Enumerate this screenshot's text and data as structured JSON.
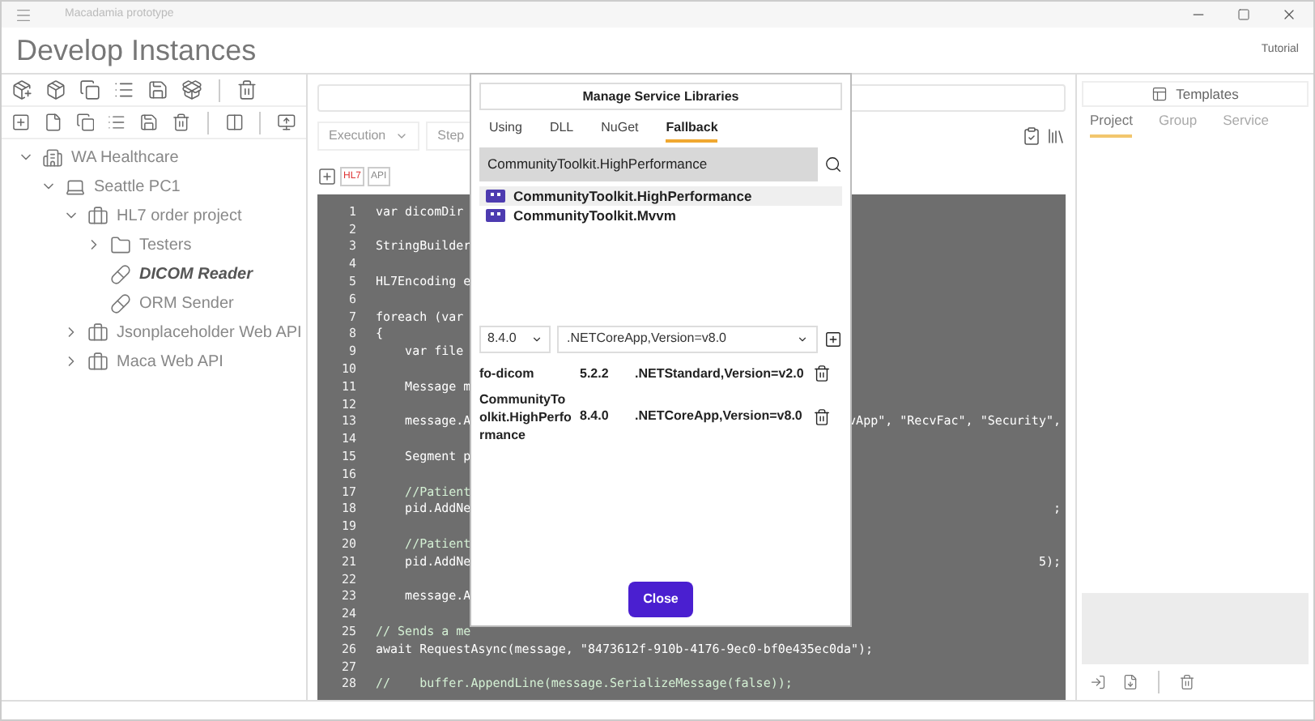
{
  "window": {
    "title": "Macadamia prototype"
  },
  "header": {
    "title": "Develop Instances",
    "link": "Tutorial"
  },
  "tree": [
    {
      "label": "WA Healthcare",
      "kind": "organization",
      "expanded": true,
      "selected": false,
      "children": [
        {
          "label": "Seattle PC1",
          "kind": "computer",
          "expanded": true,
          "selected": false,
          "children": [
            {
              "label": "HL7 order project",
              "kind": "project",
              "expanded": true,
              "selected": false,
              "children": [
                {
                  "label": "Testers",
                  "kind": "folder",
                  "expanded": false,
                  "selected": false
                },
                {
                  "label": "DICOM Reader",
                  "kind": "service",
                  "selected": true
                },
                {
                  "label": "ORM Sender",
                  "kind": "service",
                  "selected": false
                }
              ]
            },
            {
              "label": "Jsonplaceholder Web API",
              "kind": "project",
              "expanded": false,
              "selected": false
            },
            {
              "label": "Maca Web API",
              "kind": "project",
              "expanded": false,
              "selected": false
            }
          ]
        }
      ]
    }
  ],
  "editor": {
    "mode": "Execution",
    "step_button": "Step",
    "badges": [
      "HL7",
      "API"
    ],
    "lines": [
      {
        "number": "1",
        "kind": "code",
        "text": "var dicomDir"
      },
      {
        "number": "2"
      },
      {
        "number": "3",
        "kind": "code",
        "text": "StringBuilder"
      },
      {
        "number": "4"
      },
      {
        "number": "5",
        "kind": "code",
        "text": "HL7Encoding e"
      },
      {
        "number": "6"
      },
      {
        "number": "7",
        "kind": "code",
        "text": "foreach (var"
      },
      {
        "number": "8",
        "kind": "code",
        "text": "{"
      },
      {
        "number": "9",
        "kind": "code",
        "text": "    var file"
      },
      {
        "number": "10"
      },
      {
        "number": "11",
        "kind": "code",
        "text": "    Message m"
      },
      {
        "number": "12"
      },
      {
        "number": "13",
        "kind": "code",
        "text": "    message.A",
        "tail": "vApp\", \"RecvFac\", \"Security\","
      },
      {
        "number": "14"
      },
      {
        "number": "15",
        "kind": "code",
        "text": "    Segment p"
      },
      {
        "number": "16"
      },
      {
        "number": "17",
        "kind": "comment",
        "text": "    //Patient"
      },
      {
        "number": "18",
        "kind": "code",
        "text": "    pid.AddNe",
        "tail": ";"
      },
      {
        "number": "19"
      },
      {
        "number": "20",
        "kind": "comment",
        "text": "    //Patient"
      },
      {
        "number": "21",
        "kind": "code",
        "text": "    pid.AddNe",
        "tail": "5);"
      },
      {
        "number": "22"
      },
      {
        "number": "23",
        "kind": "code",
        "text": "    message.A"
      },
      {
        "number": "24"
      },
      {
        "number": "25",
        "kind": "comment",
        "text": "// Sends a me"
      },
      {
        "number": "26",
        "kind": "code",
        "text": "await RequestAsync(message, \"8473612f-910b-4176-9ec0-bf0e435ec0da\");"
      },
      {
        "number": "27"
      },
      {
        "number": "28",
        "kind": "comment",
        "text": "//    buffer.AppendLine(message.SerializeMessage(false));"
      }
    ]
  },
  "templates": {
    "title": "Templates",
    "tabs": [
      {
        "label": "Project",
        "selected": true
      },
      {
        "label": "Group",
        "selected": false
      },
      {
        "label": "Service",
        "selected": false
      }
    ]
  },
  "dialog": {
    "title": "Manage Service Libraries",
    "tabs": [
      {
        "label": "Using",
        "selected": false
      },
      {
        "label": "DLL",
        "selected": false
      },
      {
        "label": "NuGet",
        "selected": false
      },
      {
        "label": "Fallback",
        "selected": true
      }
    ],
    "search": {
      "value": "CommunityToolkit.HighPerformance"
    },
    "results": [
      {
        "name": "CommunityToolkit.HighPerformance",
        "selected": true
      },
      {
        "name": "CommunityToolkit.Mvvm",
        "selected": false
      }
    ],
    "version": "8.4.0",
    "framework": ".NETCoreApp,Version=v8.0",
    "packages": [
      {
        "name": "fo-dicom",
        "version": "5.2.2",
        "framework": ".NETStandard,Version=v2.0"
      },
      {
        "name": "CommunityToolkit.HighPerformance",
        "version": "8.4.0",
        "framework": ".NETCoreApp,Version=v8.0"
      }
    ],
    "close_button": "Close"
  }
}
